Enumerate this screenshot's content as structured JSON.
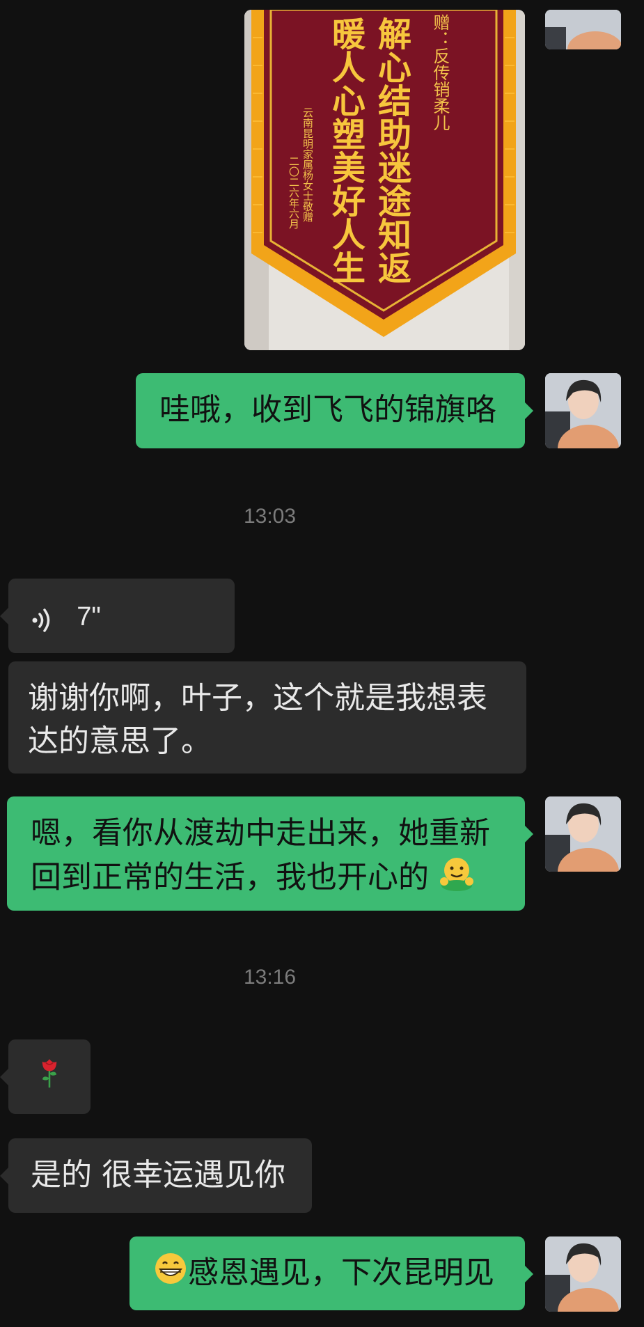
{
  "messages": {
    "banner_image": {
      "lines": [
        "赠：反传销柔儿",
        "解心结助迷途知返",
        "暖人心塑美好人生"
      ],
      "signature": [
        "云南昆明家属杨女士敬赠",
        "二〇二六年六月"
      ]
    },
    "m1": "哇哦，收到飞飞的锦旗咯",
    "time1": "13:03",
    "voice_duration": "7\"",
    "m2": "谢谢你啊，叶子，这个就是我想表达的意思了。",
    "m3": "嗯，看你从渡劫中走出来，她重新回到正常的生活，我也开心的",
    "time2": "13:16",
    "m4_emoji": "🌹",
    "m5": "是的 很幸运遇见你",
    "m6": "感恩遇见，下次昆明见"
  },
  "colors": {
    "background": "#111111",
    "green_bubble": "#3dbb73",
    "gray_bubble": "#2c2c2c",
    "time_text": "#7c7c7c"
  },
  "icons": {
    "voice": "voice-wave-icon",
    "emoji_hug": "hugging-face-emoji",
    "emoji_grin": "grinning-face-emoji",
    "emoji_rose": "rose-emoji"
  }
}
